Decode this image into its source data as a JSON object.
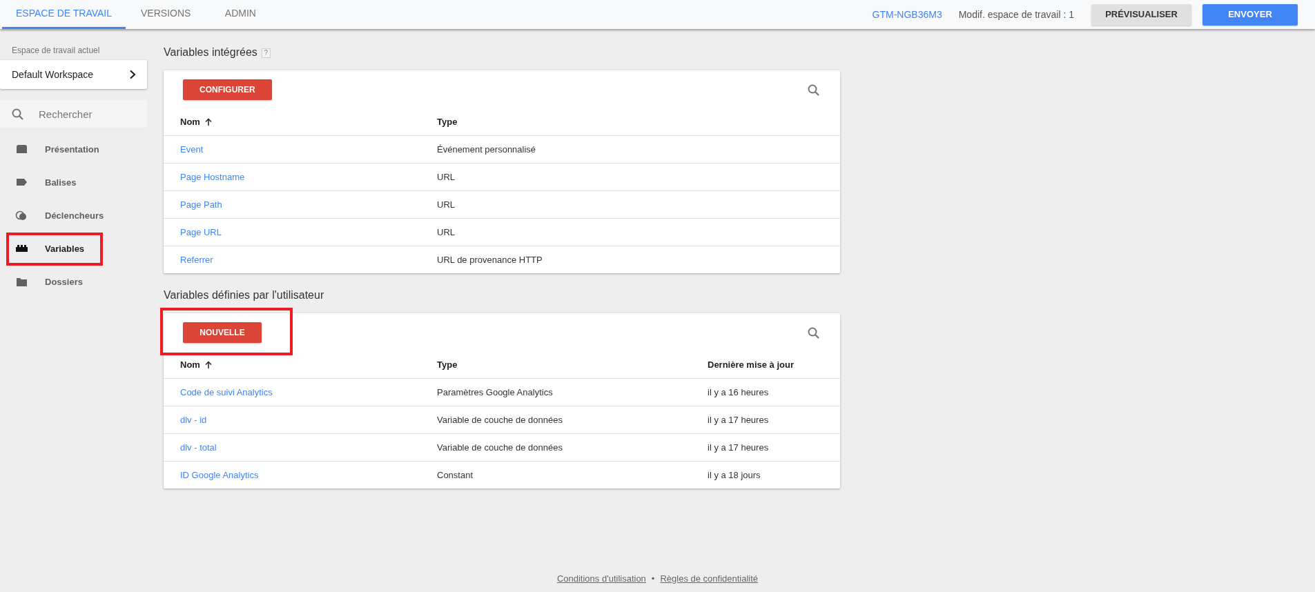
{
  "top_tabs": [
    {
      "label": "ESPACE DE TRAVAIL",
      "selected": true
    },
    {
      "label": "VERSIONS",
      "selected": false
    },
    {
      "label": "ADMIN",
      "selected": false
    }
  ],
  "container_id": "GTM-NGB36M3",
  "workspace_changes": "Modif. espace de travail : 1",
  "header_buttons": [
    {
      "label": "PRÉVISUALISER",
      "kind": "secondary"
    },
    {
      "label": "ENVOYER",
      "kind": "primary"
    }
  ],
  "sidebar": {
    "workspace_label": "Espace de travail actuel",
    "workspace_name": "Default Workspace",
    "search_placeholder": "Rechercher",
    "items": [
      {
        "label": "Présentation",
        "selected": false,
        "highlighted": false
      },
      {
        "label": "Balises",
        "selected": false,
        "highlighted": false
      },
      {
        "label": "Déclencheurs",
        "selected": false,
        "highlighted": false
      },
      {
        "label": "Variables",
        "selected": true,
        "highlighted": true
      },
      {
        "label": "Dossiers",
        "selected": false,
        "highlighted": false
      }
    ]
  },
  "sections": [
    {
      "title": "Variables intégrées",
      "help": "?",
      "action": {
        "label": "CONFIGURER",
        "highlighted": false
      },
      "columns": [
        {
          "label": "Nom",
          "sorted": true
        },
        {
          "label": "Type",
          "sorted": false
        }
      ],
      "rows": [
        [
          "Event",
          "Événement personnalisé"
        ],
        [
          "Page Hostname",
          "URL"
        ],
        [
          "Page Path",
          "URL"
        ],
        [
          "Page URL",
          "URL"
        ],
        [
          "Referrer",
          "URL de provenance HTTP"
        ]
      ]
    },
    {
      "title": "Variables définies par l'utilisateur",
      "action": {
        "label": "NOUVELLE",
        "highlighted": true
      },
      "columns": [
        {
          "label": "Nom",
          "sorted": true
        },
        {
          "label": "Type",
          "sorted": false
        },
        {
          "label": "Dernière mise à jour",
          "sorted": false
        }
      ],
      "rows": [
        [
          "Code de suivi Analytics",
          "Paramètres Google Analytics",
          "il y a 16 heures"
        ],
        [
          "dlv - id",
          "Variable de couche de données",
          "il y a 17 heures"
        ],
        [
          "dlv - total",
          "Variable de couche de données",
          "il y a 17 heures"
        ],
        [
          "ID Google Analytics",
          "Constant",
          "il y a 18 jours"
        ]
      ]
    }
  ],
  "footer_links": [
    "Conditions d'utilisation",
    "Règles de confidentialité"
  ],
  "footer_separator": "•"
}
